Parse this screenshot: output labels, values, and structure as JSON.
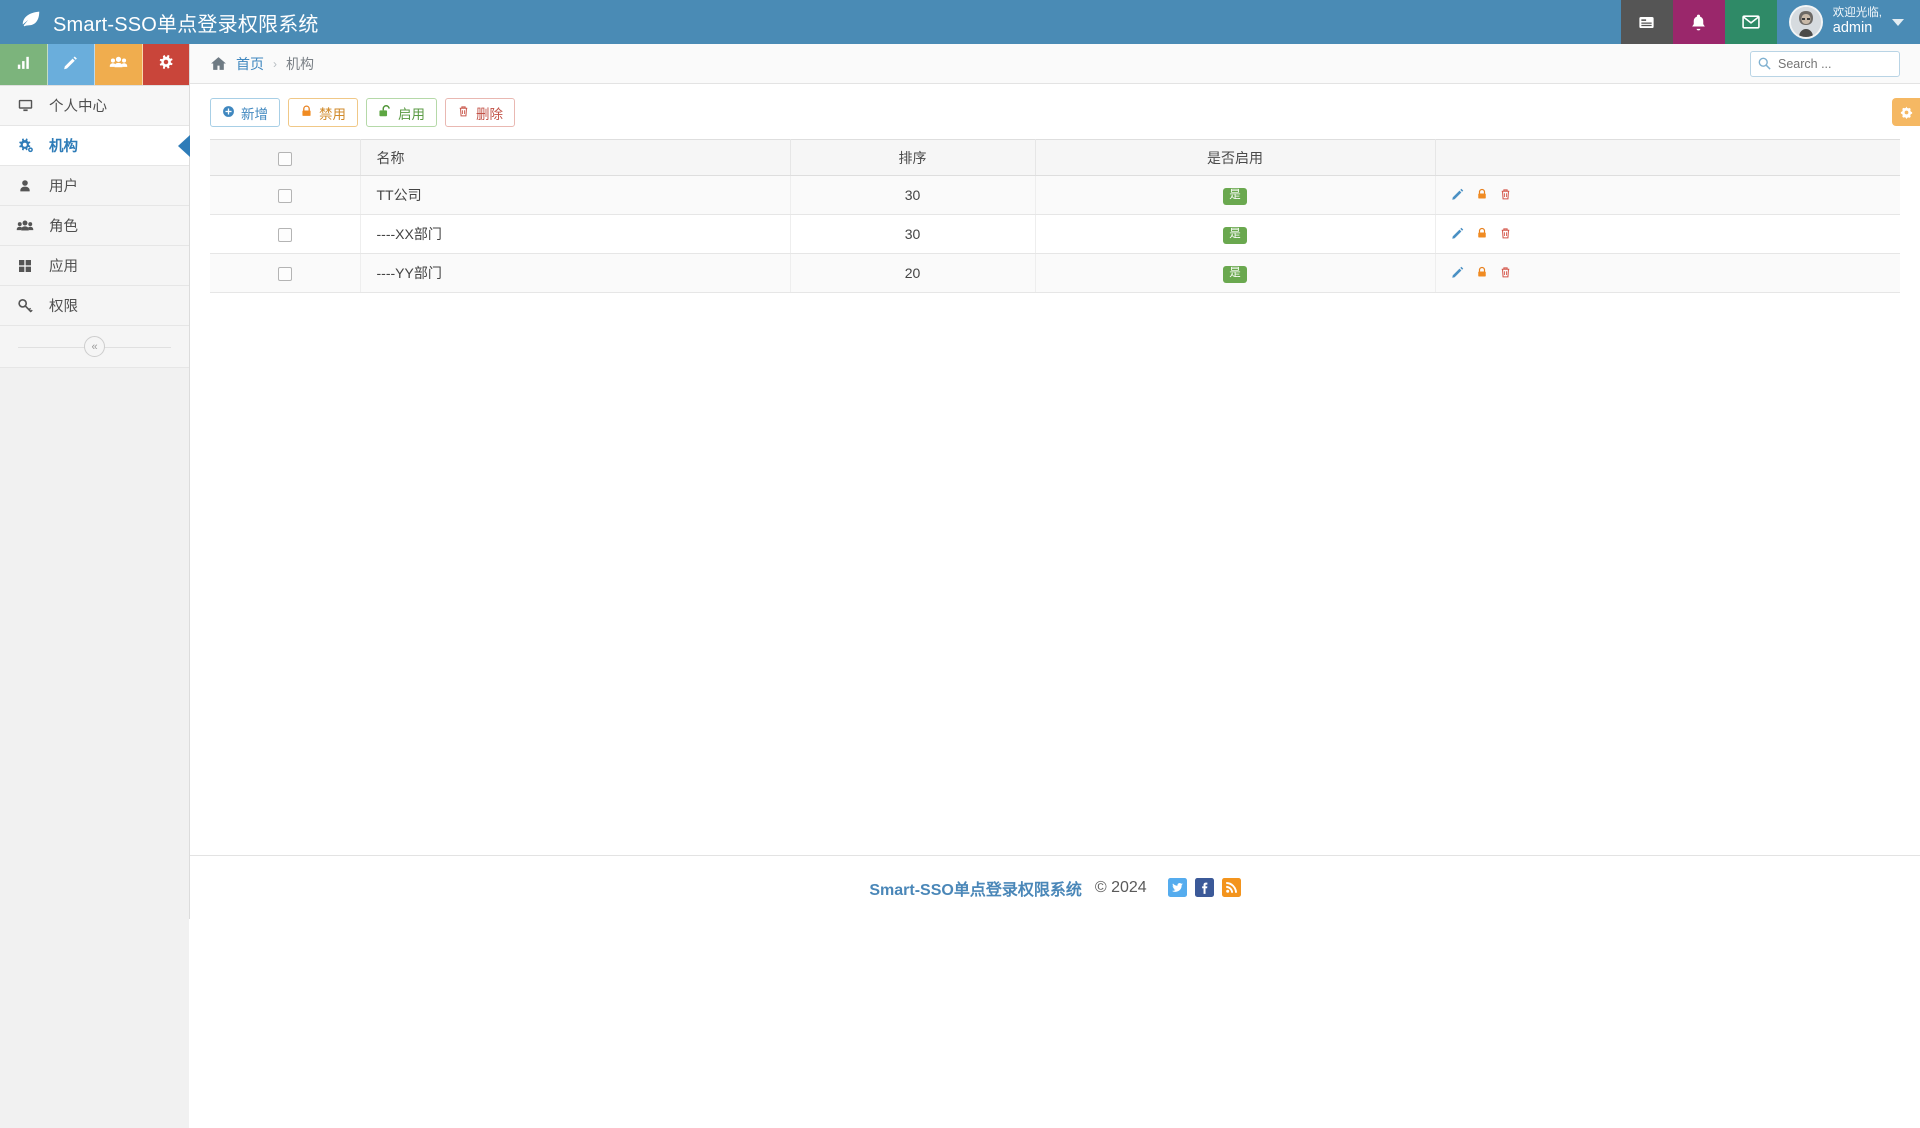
{
  "header": {
    "brand_title": "Smart-SSO单点登录权限系统",
    "brand_icon": "leaf-icon",
    "icons": [
      {
        "name": "tasks-icon",
        "color": "#555555"
      },
      {
        "name": "bell-icon",
        "color": "#9a276b"
      },
      {
        "name": "mail-icon",
        "color": "#2f8a67"
      }
    ],
    "user": {
      "welcome": "欢迎光临,",
      "username": "admin",
      "avatar": "user-avatar",
      "caret": "chevron-down-icon"
    },
    "background": "#4a8bb5"
  },
  "sidebar": {
    "tiles": [
      {
        "name": "chart-tile",
        "icon": "bar-chart-icon",
        "color": "#7cb47c"
      },
      {
        "name": "edit-tile",
        "icon": "pencil-icon",
        "color": "#6aaedc"
      },
      {
        "name": "users-tile",
        "icon": "group-icon",
        "color": "#f0ad4e"
      },
      {
        "name": "config-tile",
        "icon": "gears-icon",
        "color": "#c9453a"
      }
    ],
    "items": [
      {
        "label": "个人中心",
        "icon": "monitor-icon",
        "active": false
      },
      {
        "label": "机构",
        "icon": "gears-icon",
        "active": true
      },
      {
        "label": "用户",
        "icon": "user-icon",
        "active": false
      },
      {
        "label": "角色",
        "icon": "group-icon",
        "active": false
      },
      {
        "label": "应用",
        "icon": "grid-icon",
        "active": false
      },
      {
        "label": "权限",
        "icon": "key-icon",
        "active": false
      }
    ],
    "collapse_label": "«"
  },
  "breadcrumb": {
    "home_icon": "home-icon",
    "home_label": "首页",
    "separator": "›",
    "current": "机构"
  },
  "search": {
    "placeholder": "Search ...",
    "value": "",
    "icon": "search-icon"
  },
  "toolbar": {
    "buttons": [
      {
        "label": "新增",
        "icon": "plus-circle-icon",
        "style": "b-add"
      },
      {
        "label": "禁用",
        "icon": "lock-closed-icon",
        "style": "b-dis"
      },
      {
        "label": "启用",
        "icon": "lock-open-icon",
        "style": "b-en"
      },
      {
        "label": "删除",
        "icon": "trash-icon",
        "style": "b-del"
      }
    ],
    "settings_tab_icon": "gear-icon"
  },
  "table": {
    "columns": [
      "",
      "名称",
      "排序",
      "是否启用",
      ""
    ],
    "rows": [
      {
        "name": "TT公司",
        "sort": "30",
        "enabled": "是",
        "checked": false
      },
      {
        "name": "----XX部门",
        "sort": "30",
        "enabled": "是",
        "checked": false
      },
      {
        "name": "----YY部门",
        "sort": "20",
        "enabled": "是",
        "checked": false
      }
    ],
    "row_actions": [
      "edit-icon",
      "lock-icon",
      "delete-icon"
    ]
  },
  "footer": {
    "title": "Smart-SSO单点登录权限系统",
    "copyright": "© 2024",
    "social": [
      "twitter-icon",
      "facebook-icon",
      "rss-icon"
    ]
  }
}
